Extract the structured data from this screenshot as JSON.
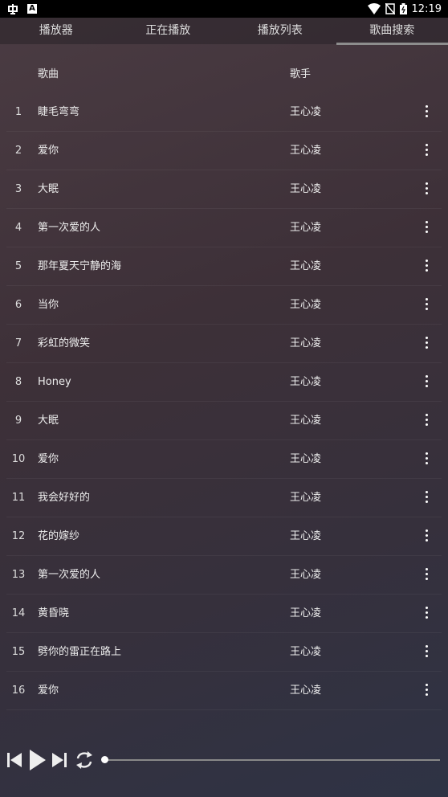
{
  "status": {
    "time": "12:19"
  },
  "tabs": [
    "播放器",
    "正在播放",
    "播放列表",
    "歌曲搜索"
  ],
  "active_tab": 3,
  "header": {
    "song": "歌曲",
    "singer": "歌手"
  },
  "songs": [
    {
      "index": "1",
      "title": "睫毛弯弯",
      "singer": "王心凌"
    },
    {
      "index": "2",
      "title": "爱你",
      "singer": "王心凌"
    },
    {
      "index": "3",
      "title": "大眠",
      "singer": "王心凌"
    },
    {
      "index": "4",
      "title": "第一次爱的人",
      "singer": "王心凌"
    },
    {
      "index": "5",
      "title": "那年夏天宁静的海",
      "singer": "王心凌"
    },
    {
      "index": "6",
      "title": "当你",
      "singer": "王心凌"
    },
    {
      "index": "7",
      "title": "彩虹的微笑",
      "singer": "王心凌"
    },
    {
      "index": "8",
      "title": "Honey",
      "singer": "王心凌"
    },
    {
      "index": "9",
      "title": "大眠",
      "singer": "王心凌"
    },
    {
      "index": "10",
      "title": "爱你",
      "singer": "王心凌"
    },
    {
      "index": "11",
      "title": "我会好好的",
      "singer": "王心凌"
    },
    {
      "index": "12",
      "title": "花的嫁纱",
      "singer": "王心凌"
    },
    {
      "index": "13",
      "title": "第一次爱的人",
      "singer": "王心凌"
    },
    {
      "index": "14",
      "title": "黄昏晓",
      "singer": "王心凌"
    },
    {
      "index": "15",
      "title": "劈你的雷正在路上",
      "singer": "王心凌"
    },
    {
      "index": "16",
      "title": "爱你",
      "singer": "王心凌"
    }
  ],
  "player": {
    "progress": 0
  }
}
